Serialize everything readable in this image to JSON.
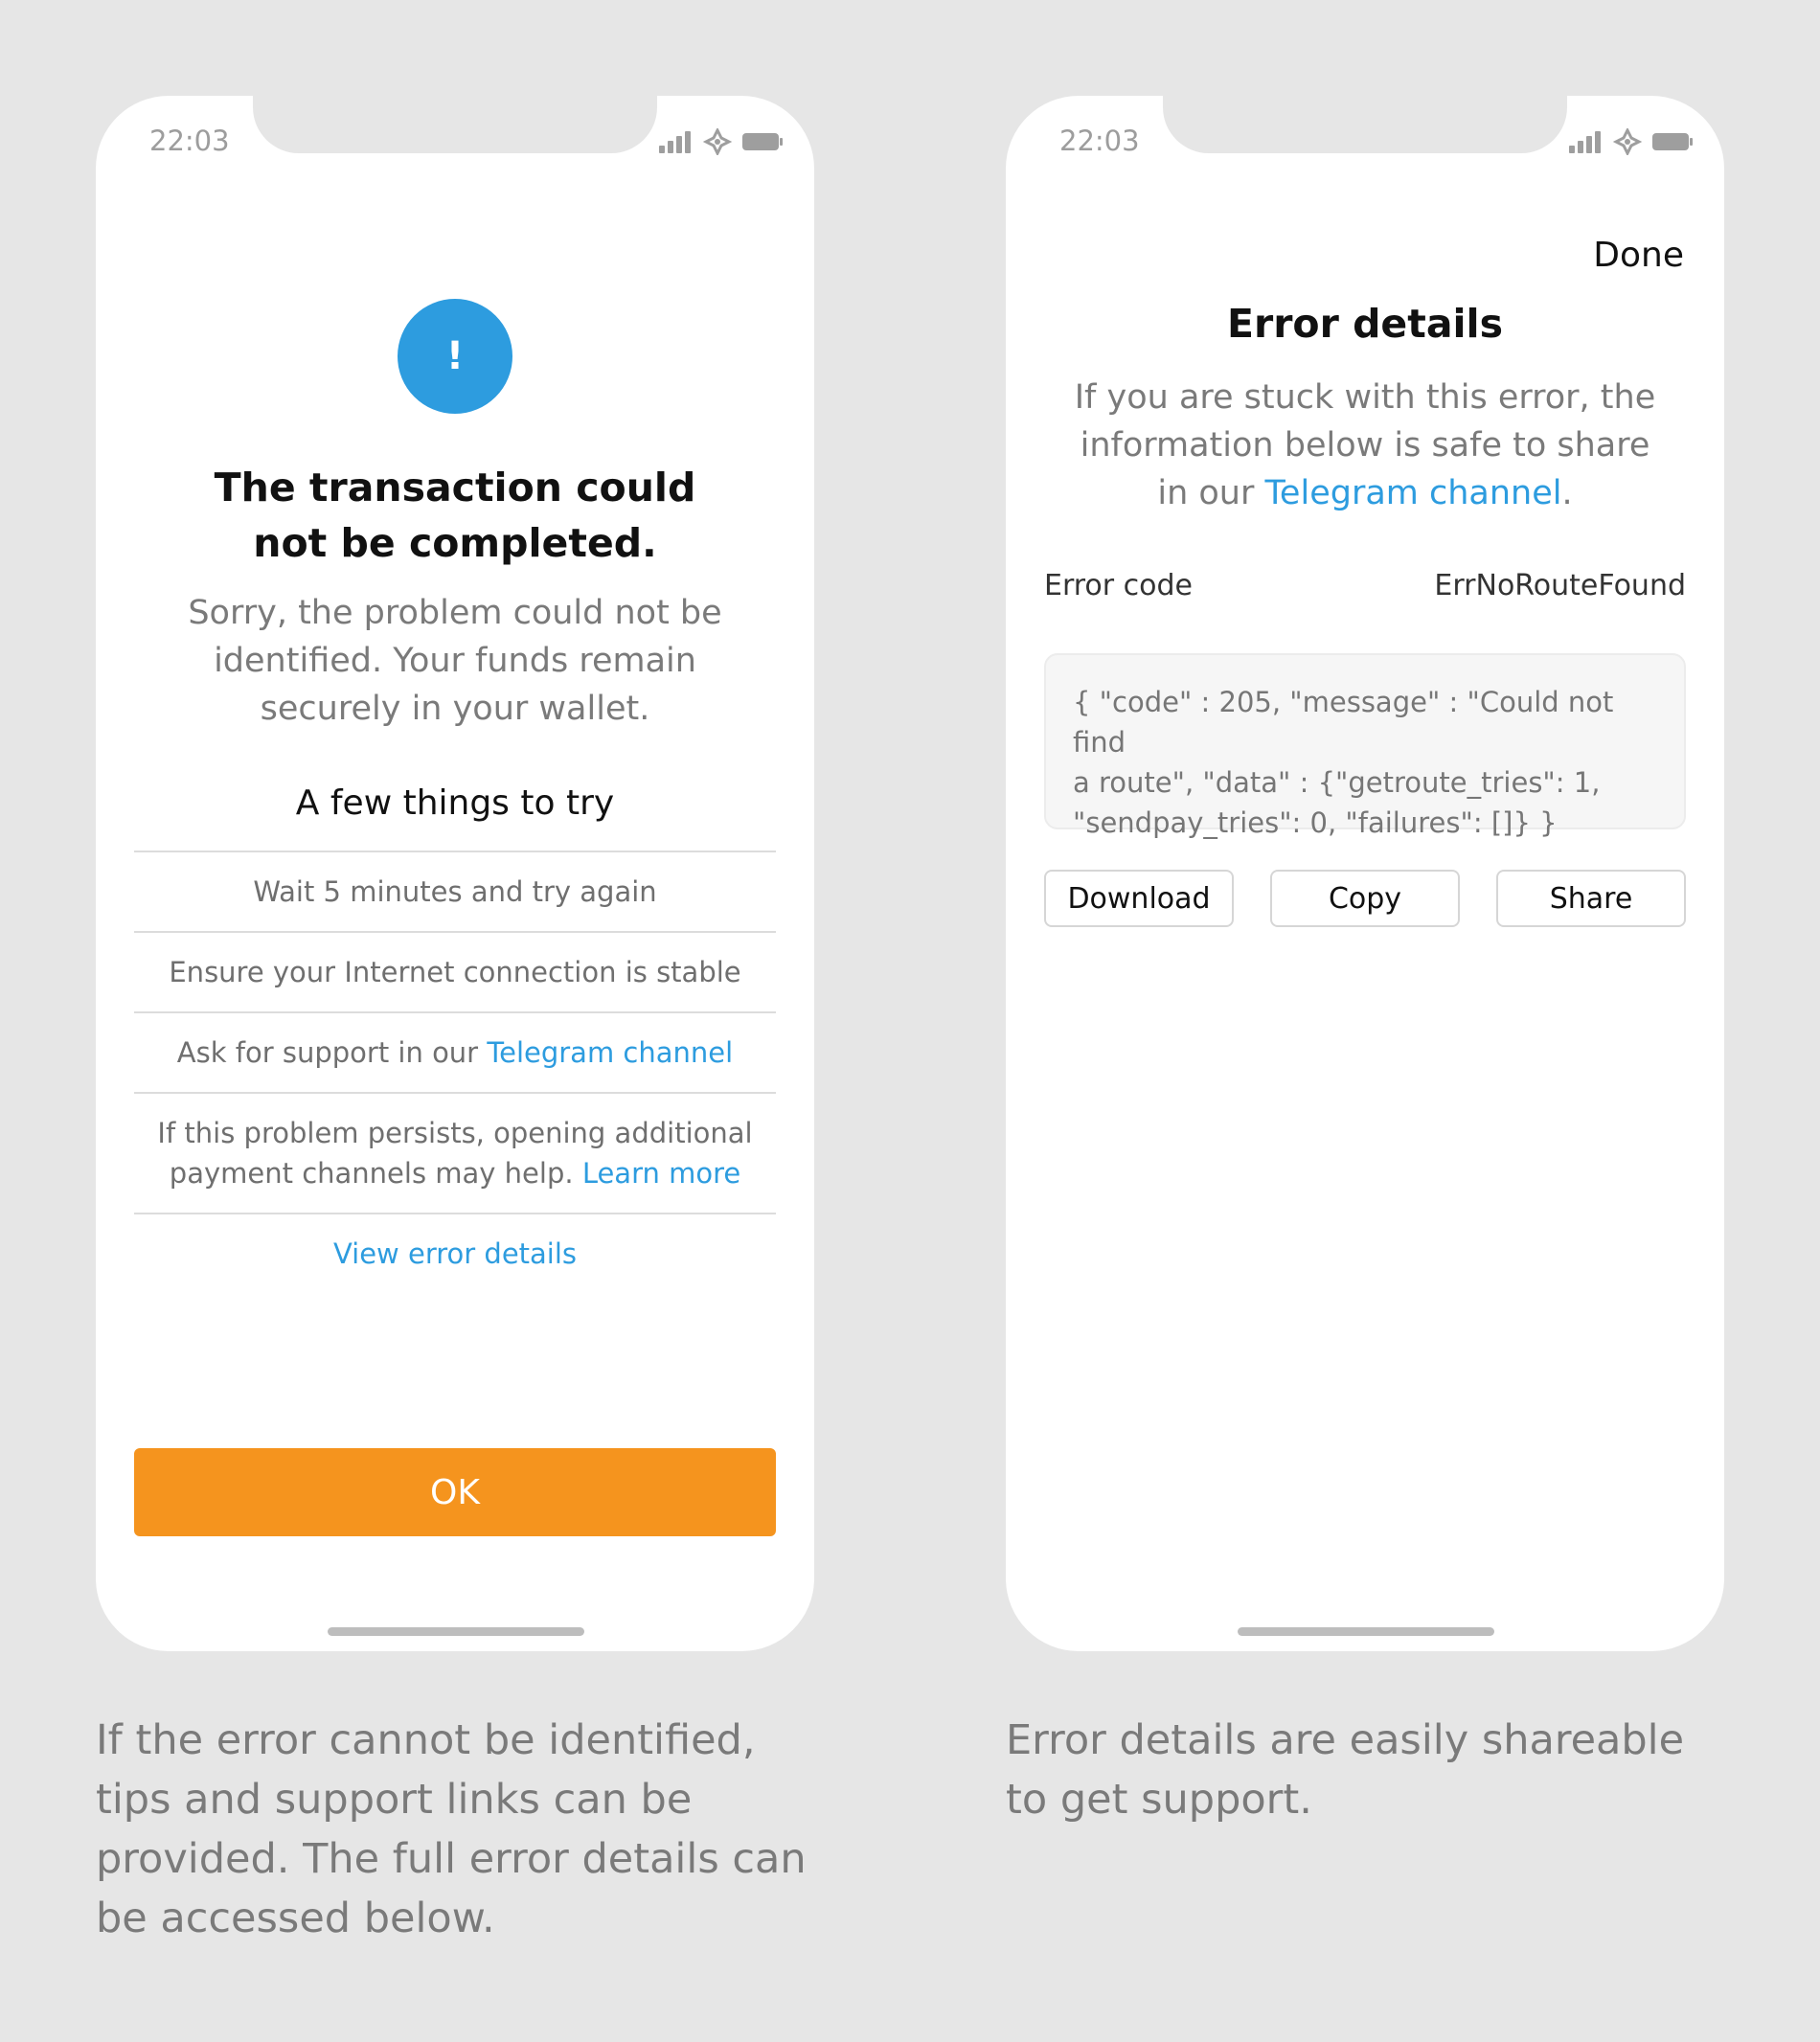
{
  "colors": {
    "background": "#e6e6e6",
    "accent_blue": "#2d9cdf",
    "ok_orange": "#f5941e"
  },
  "left_screen": {
    "status_bar": {
      "time": "22:03",
      "icons": [
        "signal-icon",
        "wifi-icon",
        "battery-icon"
      ]
    },
    "alert_icon_glyph": "!",
    "title_line1": "The transaction could",
    "title_line2": "not be completed.",
    "subtitle_line1": "Sorry, the problem could not be",
    "subtitle_line2": "identified. Your funds remain",
    "subtitle_line3": "securely in your wallet.",
    "tips_heading": "A few things to try",
    "tips": {
      "wait": "Wait 5 minutes and try again",
      "internet": "Ensure your Internet connection is stable",
      "support_prefix": "Ask for support in our ",
      "support_link": "Telegram channel",
      "channels_line1": "If this problem persists, opening additional",
      "channels_line2_prefix": "payment channels may help. ",
      "channels_link": "Learn more",
      "view_details": "View error details"
    },
    "ok_button": "OK"
  },
  "right_screen": {
    "status_bar": {
      "time": "22:03",
      "icons": [
        "signal-icon",
        "wifi-icon",
        "battery-icon"
      ]
    },
    "done_button": "Done",
    "title": "Error details",
    "subtitle_line1": "If you are stuck with this error, the",
    "subtitle_line2": "information below is safe to share",
    "subtitle_line3_prefix": "in our ",
    "subtitle_link": "Telegram channel",
    "subtitle_suffix": ".",
    "error_code_label": "Error code",
    "error_code_value": "ErrNoRouteFound",
    "json_line1": "{ \"code\" : 205, \"message\" : \"Could not find",
    "json_line2": "a route\", \"data\" : {\"getroute_tries\": 1,",
    "json_line3": "\"sendpay_tries\": 0, \"failures\": []} }",
    "actions": {
      "download": "Download",
      "copy": "Copy",
      "share": "Share"
    }
  },
  "captions": {
    "left": "If the error cannot be identified, tips and support links can be provided. The full error details can be accessed below.",
    "right": "Error details are easily shareable to get support."
  }
}
